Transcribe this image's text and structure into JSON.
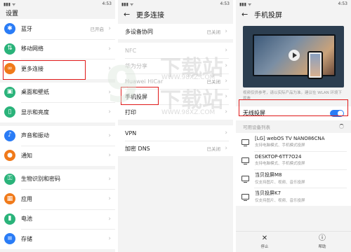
{
  "status": {
    "time_left": "4:53",
    "time_mid": "4:53",
    "time_right": "4:53",
    "signal": "▮▮▮ ᯤ"
  },
  "colors": {
    "accent": "#2a7cf6",
    "highlight": "#e01818"
  },
  "settings_screen": {
    "title": "设置",
    "items": [
      {
        "label": "蓝牙",
        "status": "已开启",
        "icon": "bluetooth-icon",
        "color": "#2a7cf6",
        "glyph": "✱"
      },
      {
        "label": "移动网络",
        "status": "",
        "icon": "mobile-network-icon",
        "color": "#2ab37a",
        "glyph": "⇅"
      },
      {
        "label": "更多连接",
        "status": "",
        "icon": "more-connections-icon",
        "color": "#f07a1a",
        "glyph": "∞"
      },
      {
        "label": "桌面和壁纸",
        "status": "",
        "icon": "wallpaper-icon",
        "color": "#2ab37a",
        "glyph": "▣"
      },
      {
        "label": "显示和亮度",
        "status": "",
        "icon": "display-icon",
        "color": "#2ab37a",
        "glyph": "▯"
      },
      {
        "label": "声音和振动",
        "status": "",
        "icon": "sound-icon",
        "color": "#2a7cf6",
        "glyph": "♪"
      },
      {
        "label": "通知",
        "status": "",
        "icon": "notification-icon",
        "color": "#f07a1a",
        "glyph": "●"
      },
      {
        "label": "生物识别和密码",
        "status": "",
        "icon": "biometrics-icon",
        "color": "#2ab37a",
        "glyph": "⚿"
      },
      {
        "label": "应用",
        "status": "",
        "icon": "apps-icon",
        "color": "#f07a1a",
        "glyph": "▦"
      },
      {
        "label": "电池",
        "status": "",
        "icon": "battery-icon",
        "color": "#2ab37a",
        "glyph": "▮"
      },
      {
        "label": "存储",
        "status": "",
        "icon": "storage-icon",
        "color": "#2a7cf6",
        "glyph": "≡"
      }
    ]
  },
  "more_connections_screen": {
    "title": "更多连接",
    "items": [
      {
        "label": "多设备协同",
        "status": "已关闭"
      },
      {
        "label": "NFC",
        "status": ""
      },
      {
        "label": "华为分享",
        "status": ""
      },
      {
        "label": "Huawei HiCar",
        "status": "已关闭"
      },
      {
        "label": "手机投屏",
        "status": ""
      },
      {
        "label": "打印",
        "status": ""
      },
      {
        "label": "VPN",
        "status": ""
      },
      {
        "label": "加密 DNS",
        "status": "已关闭"
      }
    ]
  },
  "projection_screen": {
    "title": "手机投屏",
    "description": "视频仅供参考，请以实际产品为准。建议在 WLAN 环境下观看",
    "wireless_label": "无线投屏",
    "wireless_on": true,
    "devices_header": "可用设备列表",
    "devices": [
      {
        "name": "[LG] webOS TV NANO86CNA",
        "sub": "支持电脑模式、手机模式投屏"
      },
      {
        "name": "DESKTOP-6TT7O24",
        "sub": "支持电脑模式、手机模式投屏"
      },
      {
        "name": "当贝投屏M8",
        "sub": "仅支持图片、视频、音乐投屏"
      },
      {
        "name": "当贝投屏K7",
        "sub": "仅支持图片、视频、音乐投屏"
      }
    ],
    "bottom": {
      "stop_label": "停止",
      "help_label": "帮助",
      "stop_icon": "✕",
      "help_icon": "ⓘ"
    }
  },
  "watermark": {
    "site": "下载站",
    "url": "WWW.98XZ.COM",
    "digit": "9"
  }
}
